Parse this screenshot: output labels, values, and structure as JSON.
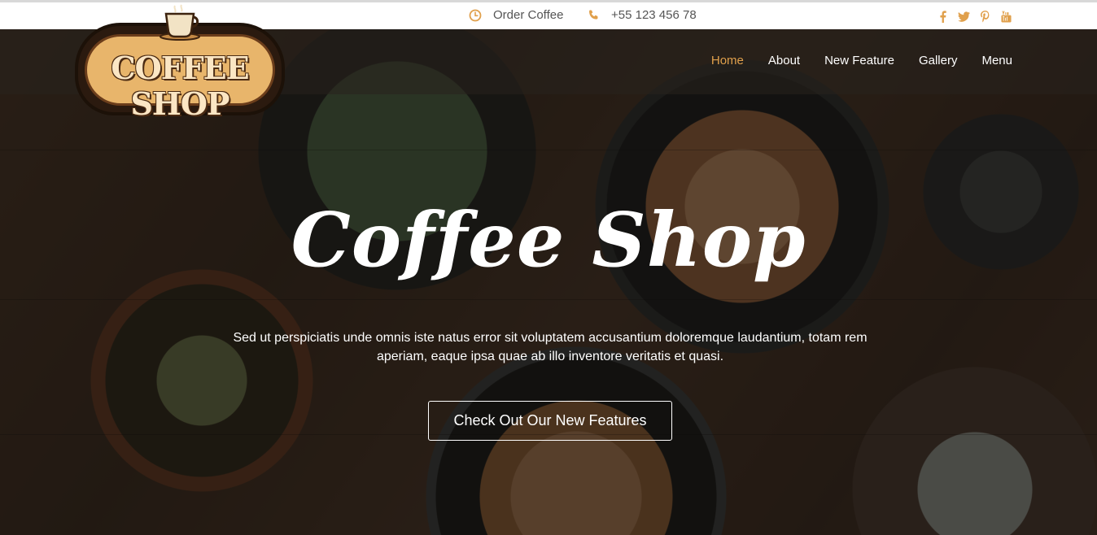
{
  "topbar": {
    "order_label": "Order Coffee",
    "order_icon": "clock-icon",
    "phone_label": "+55 123 456 78",
    "phone_icon": "phone-icon",
    "social": [
      {
        "name": "facebook-icon"
      },
      {
        "name": "twitter-icon"
      },
      {
        "name": "pinterest-icon"
      },
      {
        "name": "youtube-icon"
      }
    ]
  },
  "logo": {
    "text": "COFFEE SHOP",
    "icon": "coffee-cup-icon"
  },
  "nav": {
    "items": [
      {
        "label": "Home",
        "active": true
      },
      {
        "label": "About",
        "active": false
      },
      {
        "label": "New Feature",
        "active": false
      },
      {
        "label": "Gallery",
        "active": false
      },
      {
        "label": "Menu",
        "active": false
      }
    ]
  },
  "hero": {
    "title": "Coffee Shop",
    "description": "Sed ut perspiciatis unde omnis iste natus error sit voluptatem accusantium doloremque laudantium, totam rem aperiam, eaque ipsa quae ab illo inventore veritatis et quasi.",
    "cta_label": "Check Out Our New Features"
  },
  "colors": {
    "accent": "#e0a04c",
    "overlay": "#120e0a"
  }
}
